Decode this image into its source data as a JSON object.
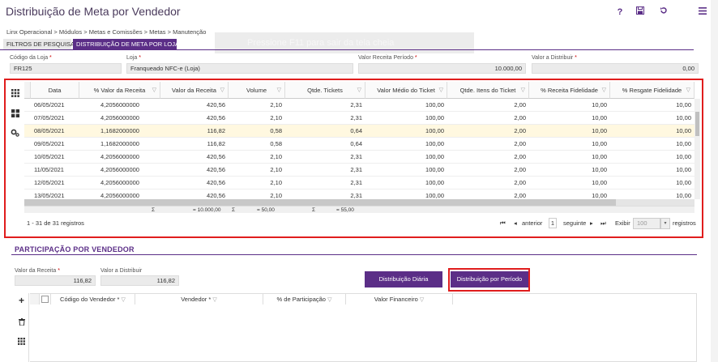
{
  "header": {
    "title": "Distribuição de Meta por Vendedor",
    "help_label": "?",
    "save_icon": "save-icon",
    "refresh_icon": "refresh-icon",
    "menu_icon": "menu-icon"
  },
  "breadcrumb": "Linx Operacional  >  Módulos  >  Metas e Comissões  >  Metas  >  Manutenção",
  "tabs": [
    {
      "label": "FILTROS DE PESQUISA"
    },
    {
      "label": "DISTRIBUIÇÃO DE META POR LOJA"
    }
  ],
  "ghost_text": "Pressione  F11  para sair da tela cheia",
  "filters": {
    "codigo_loja": {
      "label": "Código da Loja",
      "value": "FR125"
    },
    "loja": {
      "label": "Loja",
      "value": "Franqueado NFC-e (Loja)"
    },
    "valor_receita_periodo": {
      "label": "Valor Receita Período",
      "value": "10.000,00"
    },
    "valor_distribuir": {
      "label": "Valor a Distribuir",
      "value": "0,00"
    }
  },
  "grid": {
    "columns": [
      "Data",
      "% Valor da Receita",
      "Valor da Receita",
      "Volume",
      "Qtde. Tickets",
      "Valor Médio do Ticket",
      "Qtde. Itens do Ticket",
      "% Receita Fidelidade",
      "% Resgate Fidelidade"
    ],
    "rows": [
      [
        "06/05/2021",
        "4,2056000000",
        "420,56",
        "2,10",
        "2,31",
        "100,00",
        "2,00",
        "10,00",
        "10,00"
      ],
      [
        "07/05/2021",
        "4,2056000000",
        "420,56",
        "2,10",
        "2,31",
        "100,00",
        "2,00",
        "10,00",
        "10,00"
      ],
      [
        "08/05/2021",
        "1,1682000000",
        "116,82",
        "0,58",
        "0,64",
        "100,00",
        "2,00",
        "10,00",
        "10,00"
      ],
      [
        "09/05/2021",
        "1,1682000000",
        "116,82",
        "0,58",
        "0,64",
        "100,00",
        "2,00",
        "10,00",
        "10,00"
      ],
      [
        "10/05/2021",
        "4,2056000000",
        "420,56",
        "2,10",
        "2,31",
        "100,00",
        "2,00",
        "10,00",
        "10,00"
      ],
      [
        "11/05/2021",
        "4,2056000000",
        "420,56",
        "2,10",
        "2,31",
        "100,00",
        "2,00",
        "10,00",
        "10,00"
      ],
      [
        "12/05/2021",
        "4,2056000000",
        "420,56",
        "2,10",
        "2,31",
        "100,00",
        "2,00",
        "10,00",
        "10,00"
      ],
      [
        "13/05/2021",
        "4,2056000000",
        "420,56",
        "2,10",
        "2,31",
        "100,00",
        "2,00",
        "10,00",
        "10,00"
      ]
    ],
    "selected_row": 2,
    "sums": {
      "valor_receita": "= 10.000,00",
      "volume": "= 50,00",
      "qtde_tickets": "= 55,00"
    },
    "sum_symbol": "Σ"
  },
  "pagination": {
    "records": "1 - 31 de 31 registros",
    "anterior": "anterior",
    "page": "1",
    "seguinte": "seguinte",
    "exibir": "Exibir",
    "page_size": "100",
    "registros": "registros"
  },
  "section2": {
    "title": "PARTICIPAÇÃO POR VENDEDOR",
    "valor_receita": {
      "label": "Valor da Receita",
      "value": "116,82"
    },
    "valor_distribuir": {
      "label": "Valor a Distribuir",
      "value": "116,82"
    },
    "btn_diaria": "Distribuição Diária",
    "btn_periodo": "Distribuição por Período",
    "columns": [
      "Código do Vendedor *",
      "Vendedor *",
      "% de Participação",
      "Valor Financeiro"
    ]
  },
  "colors": {
    "accent": "#5b2e87",
    "highlight": "#e01d1d"
  }
}
